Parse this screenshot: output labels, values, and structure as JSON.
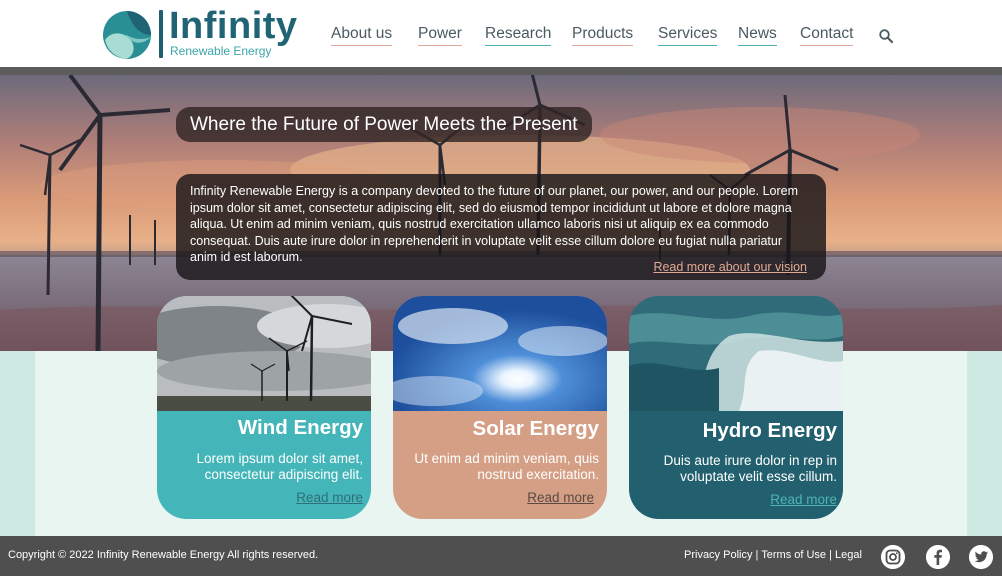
{
  "brand": {
    "name": "Infinity",
    "tagline": "Renewable Energy",
    "colors": {
      "teal_dark": "#1f6374",
      "teal": "#44b5b9",
      "peach": "#d49f85",
      "hydro": "#22606f"
    }
  },
  "nav": {
    "items": [
      {
        "label": "About us",
        "underline": "peach"
      },
      {
        "label": "Power",
        "underline": "peach"
      },
      {
        "label": "Research",
        "underline": "teal"
      },
      {
        "label": "Products",
        "underline": "peach"
      },
      {
        "label": "Services",
        "underline": "teal"
      },
      {
        "label": "News",
        "underline": "teal"
      },
      {
        "label": "Contact",
        "underline": "peach"
      }
    ],
    "search_icon": "search-icon"
  },
  "hero": {
    "headline": "Where the Future of Power Meets the Present",
    "intro": "Infinity Renewable Energy is a company devoted to the future of our planet, our power, and our people. Lorem ipsum dolor sit amet, consectetur adipiscing elit, sed do eiusmod tempor incididunt ut labore et dolore magna aliqua. Ut enim ad minim veniam, quis nostrud exercitation ullamco laboris nisi ut aliquip ex ea commodo consequat. Duis aute irure dolor in reprehenderit in voluptate velit esse cillum dolore eu fugiat nulla pariatur anim id est laborum.",
    "link": "Read more about our vision"
  },
  "cards": [
    {
      "title": "Wind Energy",
      "text": "Lorem ipsum dolor sit amet, consectetur adipiscing elit.",
      "link": "Read more",
      "link_color": "#2f6f78"
    },
    {
      "title": "Solar Energy",
      "text": "Ut enim ad minim veniam, quis nostrud exercitation.",
      "link": "Read more",
      "link_color": "#5b4a44"
    },
    {
      "title": "Hydro Energy",
      "text": "Duis aute irure dolor in rep in voluptate velit esse cillum.",
      "link": "Read more",
      "link_color": "#4fb3b3"
    }
  ],
  "footer": {
    "copyright": "Copyright © 2022 Infinity Renewable Energy All rights reserved.",
    "privacy": "Privacy Policy",
    "terms": "Terms of Use",
    "legal": "Legal",
    "separator": "|",
    "social": [
      "instagram-icon",
      "facebook-icon",
      "twitter-icon"
    ]
  }
}
